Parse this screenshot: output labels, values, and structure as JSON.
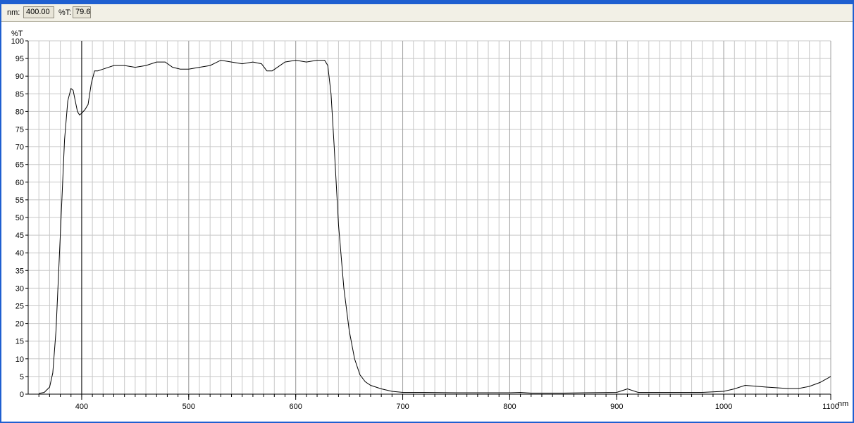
{
  "toolbar": {
    "nm_label": "nm:",
    "nm_value": "400.00",
    "t_label": "%T:",
    "t_value": "79.6"
  },
  "colors": {
    "title_bar": "#1f5fd0",
    "panel": "#f2f0e6",
    "grid": "#c8c8c8",
    "curve": "#000000"
  },
  "chart_data": {
    "type": "line",
    "ylabel": "%T",
    "xlabel": "nm",
    "xlim": [
      350,
      1100
    ],
    "ylim": [
      0,
      100
    ],
    "x_ticks": [
      400,
      500,
      600,
      700,
      800,
      900,
      1000,
      1100
    ],
    "y_ticks": [
      0,
      5,
      10,
      15,
      20,
      25,
      30,
      35,
      40,
      45,
      50,
      55,
      60,
      65,
      70,
      75,
      80,
      85,
      90,
      95,
      100
    ],
    "x_grid_step": 10,
    "cursor_x": 400,
    "grid": true,
    "series": [
      {
        "x": [
          360,
          365,
          370,
          373,
          376,
          380,
          384,
          387,
          390,
          392,
          394,
          396,
          398,
          400,
          403,
          406,
          409,
          412,
          415,
          420,
          430,
          440,
          450,
          460,
          470,
          478,
          485,
          492,
          500,
          510,
          520,
          530,
          540,
          550,
          560,
          568,
          573,
          578,
          583,
          590,
          600,
          610,
          620,
          627,
          630,
          633,
          636,
          640,
          645,
          650,
          655,
          660,
          665,
          670,
          680,
          690,
          700,
          720,
          750,
          780,
          800,
          810,
          820,
          850,
          870,
          900,
          910,
          920,
          950,
          980,
          1000,
          1010,
          1020,
          1040,
          1060,
          1070,
          1080,
          1090,
          1100
        ],
        "y": [
          0.2,
          0.5,
          2,
          6,
          18,
          45,
          72,
          83,
          86.5,
          86,
          83,
          80,
          79,
          79.5,
          80.5,
          82,
          88,
          91.5,
          91.5,
          92,
          93,
          93,
          92.5,
          93,
          94,
          94,
          92.5,
          92,
          92,
          92.5,
          93,
          94.5,
          94,
          93.5,
          94,
          93.5,
          91.5,
          91.5,
          92.5,
          94,
          94.5,
          94,
          94.5,
          94.5,
          93,
          85,
          70,
          48,
          30,
          18,
          10,
          5.5,
          3.5,
          2.5,
          1.5,
          0.8,
          0.5,
          0.5,
          0.4,
          0.4,
          0.4,
          0.5,
          0.3,
          0.3,
          0.4,
          0.5,
          1.5,
          0.5,
          0.5,
          0.5,
          0.8,
          1.5,
          2.5,
          2,
          1.6,
          1.6,
          2.2,
          3.3,
          5
        ]
      }
    ]
  }
}
